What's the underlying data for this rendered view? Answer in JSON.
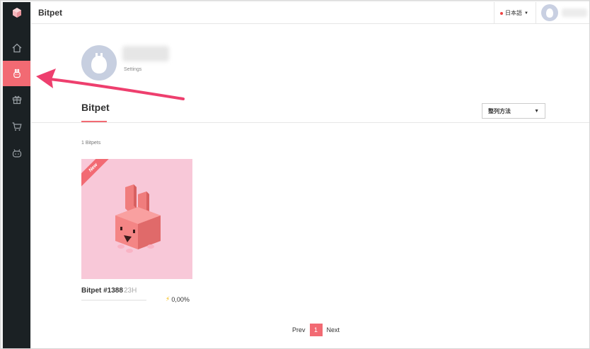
{
  "header": {
    "app_title": "Bitpet",
    "language": "日本語"
  },
  "sidebar": {
    "items": [
      {
        "name": "home",
        "icon": "home-icon"
      },
      {
        "name": "bitpet",
        "icon": "bunny-icon",
        "active": true
      },
      {
        "name": "gift",
        "icon": "gift-icon"
      },
      {
        "name": "shop",
        "icon": "cart-icon"
      },
      {
        "name": "bot",
        "icon": "robot-icon"
      }
    ]
  },
  "profile": {
    "settings_label": "Settings"
  },
  "section": {
    "title": "Bitpet",
    "sort_label": "整列方法",
    "count_label": "1 Bitpets"
  },
  "cards": [
    {
      "badge": "New",
      "name": "Bitpet #1388",
      "age": "23H",
      "energy": "0,00%"
    }
  ],
  "pagination": {
    "prev": "Prev",
    "current": "1",
    "next": "Next"
  },
  "colors": {
    "accent": "#f26a73",
    "sidebar_bg": "#1b2124",
    "card_bg": "#f8c8d8",
    "annotation_arrow": "#ee3f6e"
  }
}
